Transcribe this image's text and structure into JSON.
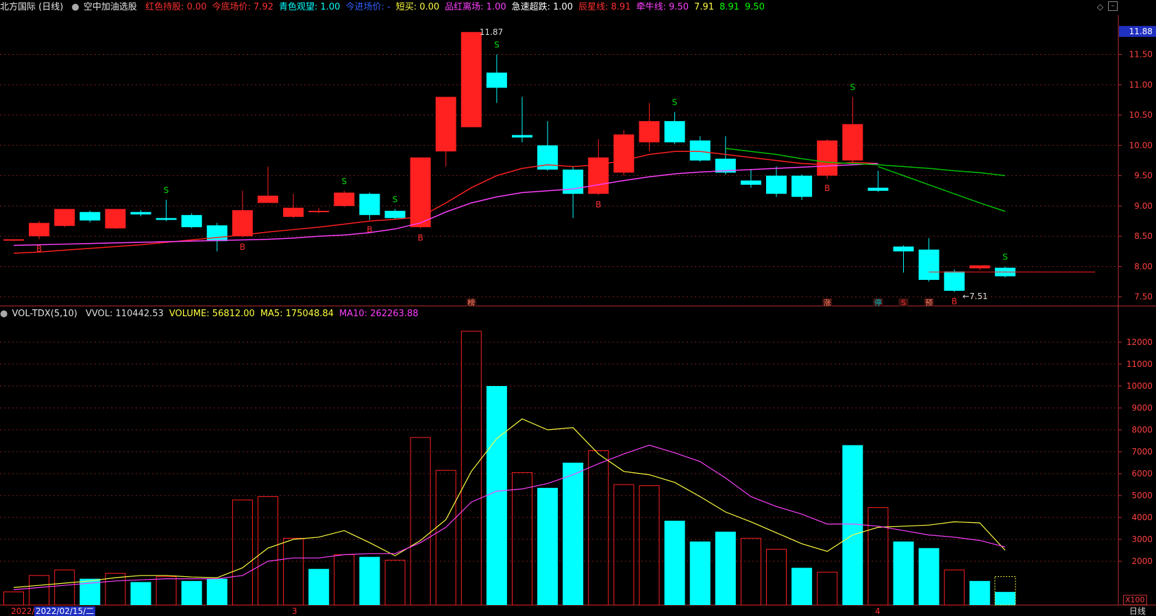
{
  "header": {
    "stock": "北方国际 (日线)",
    "formula": "空中加油选股",
    "items": [
      {
        "label": "红色持股:",
        "value": "0.00",
        "color": "#ff3030"
      },
      {
        "label": "今底场价:",
        "value": "7.92",
        "color": "#ff3030"
      },
      {
        "label": "青色观望:",
        "value": "1.00",
        "color": "#00ffff"
      },
      {
        "label": "今进场价:",
        "value": "-",
        "color": "#3060ff"
      },
      {
        "label": "短买:",
        "value": "0.00",
        "color": "#ffff40"
      },
      {
        "label": "品红离场:",
        "value": "1.00",
        "color": "#ff40ff"
      },
      {
        "label": "急速超跌:",
        "value": "1.00",
        "color": "#ffffff"
      },
      {
        "label": "辰星线:",
        "value": "8.91",
        "color": "#ff3030"
      },
      {
        "label": "牵牛线:",
        "value": "9.50",
        "color": "#ff40ff"
      },
      {
        "label": "",
        "value": "7.91",
        "color": "#ffff40"
      },
      {
        "label": "",
        "value": "8.91",
        "color": "#00ff00"
      },
      {
        "label": "",
        "value": "9.50",
        "color": "#00ff00"
      }
    ]
  },
  "volume_header": {
    "name": "VOL-TDX(5,10)",
    "items": [
      {
        "label": "VVOL:",
        "value": "110442.53",
        "color": "#dddddd"
      },
      {
        "label": "VOLUME:",
        "value": "56812.00",
        "color": "#ffff40"
      },
      {
        "label": "MA5:",
        "value": "175048.84",
        "color": "#ffff40"
      },
      {
        "label": "MA10:",
        "value": "262263.88",
        "color": "#ff40ff"
      }
    ]
  },
  "footer": {
    "date_partial": "2022/0",
    "date_cursor": "2022/02/15/二",
    "month_labels": [
      "3",
      "4"
    ],
    "period": "日线",
    "vol_unit": "X100"
  },
  "markers": {
    "high": "11.87",
    "low": "←7.51",
    "current_price": "11.88",
    "events": [
      "榜",
      "涨",
      "停",
      "S",
      "预"
    ]
  },
  "colors": {
    "up": "#ff2020",
    "down": "#00ffff",
    "ma_red": "#ff2020",
    "ma_magenta": "#ff40ff",
    "ma_green": "#00c000",
    "vol_ma5": "#ffff40",
    "vol_ma10": "#ff40ff",
    "axis": "#c03030"
  },
  "chart_data": [
    {
      "type": "candlestick",
      "yticks": [
        8.0,
        8.5,
        9.0,
        9.5,
        10.0,
        10.5,
        11.0,
        11.5,
        7.5
      ],
      "ylim": [
        7.35,
        12.15
      ],
      "candles": [
        {
          "o": 8.43,
          "c": 8.45,
          "h": 8.45,
          "l": 8.42,
          "sig": ""
        },
        {
          "o": 8.5,
          "c": 8.72,
          "h": 8.75,
          "l": 8.45,
          "sig": "B"
        },
        {
          "o": 8.67,
          "c": 8.95,
          "h": 8.95,
          "l": 8.65,
          "sig": ""
        },
        {
          "o": 8.9,
          "c": 8.76,
          "h": 8.92,
          "l": 8.73,
          "sig": ""
        },
        {
          "o": 8.63,
          "c": 8.95,
          "h": 8.95,
          "l": 8.62,
          "sig": ""
        },
        {
          "o": 8.9,
          "c": 8.86,
          "h": 8.93,
          "l": 8.83,
          "sig": ""
        },
        {
          "o": 8.8,
          "c": 8.77,
          "h": 9.1,
          "l": 8.75,
          "sig": "S"
        },
        {
          "o": 8.85,
          "c": 8.65,
          "h": 8.88,
          "l": 8.63,
          "sig": ""
        },
        {
          "o": 8.68,
          "c": 8.42,
          "h": 8.72,
          "l": 8.25,
          "sig": ""
        },
        {
          "o": 8.5,
          "c": 8.93,
          "h": 9.25,
          "l": 8.48,
          "sig": "B"
        },
        {
          "o": 9.05,
          "c": 9.17,
          "h": 9.65,
          "l": 9.05,
          "sig": ""
        },
        {
          "o": 8.82,
          "c": 8.97,
          "h": 9.2,
          "l": 8.8,
          "sig": ""
        },
        {
          "o": 8.92,
          "c": 8.92,
          "h": 8.97,
          "l": 8.88,
          "sig": ""
        },
        {
          "o": 9.0,
          "c": 9.22,
          "h": 9.25,
          "l": 8.98,
          "sig": "S"
        },
        {
          "o": 9.2,
          "c": 8.85,
          "h": 9.22,
          "l": 8.77,
          "sig": "B"
        },
        {
          "o": 8.92,
          "c": 8.8,
          "h": 8.95,
          "l": 8.78,
          "sig": "S"
        },
        {
          "o": 8.65,
          "c": 9.8,
          "h": 9.8,
          "l": 8.63,
          "sig": "B"
        },
        {
          "o": 9.9,
          "c": 10.8,
          "h": 10.8,
          "l": 9.65,
          "sig": ""
        },
        {
          "o": 10.3,
          "c": 11.87,
          "h": 11.87,
          "l": 10.3,
          "sig": ""
        },
        {
          "o": 11.2,
          "c": 10.95,
          "h": 11.5,
          "l": 10.7,
          "sig": "S"
        },
        {
          "o": 10.17,
          "c": 10.13,
          "h": 10.8,
          "l": 10.05,
          "sig": ""
        },
        {
          "o": 10.0,
          "c": 9.6,
          "h": 10.4,
          "l": 9.58,
          "sig": ""
        },
        {
          "o": 9.6,
          "c": 9.2,
          "h": 9.65,
          "l": 8.8,
          "sig": ""
        },
        {
          "o": 9.2,
          "c": 9.8,
          "h": 10.1,
          "l": 9.18,
          "sig": "B"
        },
        {
          "o": 9.55,
          "c": 10.18,
          "h": 10.25,
          "l": 9.5,
          "sig": ""
        },
        {
          "o": 10.05,
          "c": 10.4,
          "h": 10.7,
          "l": 9.9,
          "sig": ""
        },
        {
          "o": 10.4,
          "c": 10.05,
          "h": 10.55,
          "l": 10.02,
          "sig": "S"
        },
        {
          "o": 10.08,
          "c": 9.75,
          "h": 10.15,
          "l": 9.73,
          "sig": ""
        },
        {
          "o": 9.78,
          "c": 9.55,
          "h": 10.15,
          "l": 9.52,
          "sig": ""
        },
        {
          "o": 9.42,
          "c": 9.35,
          "h": 9.6,
          "l": 9.3,
          "sig": ""
        },
        {
          "o": 9.5,
          "c": 9.2,
          "h": 9.65,
          "l": 9.15,
          "sig": ""
        },
        {
          "o": 9.5,
          "c": 9.15,
          "h": 9.52,
          "l": 9.1,
          "sig": ""
        },
        {
          "o": 9.5,
          "c": 10.08,
          "h": 10.1,
          "l": 9.45,
          "sig": "B"
        },
        {
          "o": 9.75,
          "c": 10.35,
          "h": 10.8,
          "l": 9.72,
          "sig": "S"
        },
        {
          "o": 9.3,
          "c": 9.25,
          "h": 9.58,
          "l": 9.23,
          "sig": ""
        },
        {
          "o": 8.33,
          "c": 8.25,
          "h": 8.35,
          "l": 7.9,
          "sig": ""
        },
        {
          "o": 8.28,
          "c": 7.78,
          "h": 8.47,
          "l": 7.75,
          "sig": ""
        },
        {
          "o": 7.92,
          "c": 7.6,
          "h": 7.95,
          "l": 7.58,
          "sig": "B"
        },
        {
          "o": 7.97,
          "c": 8.02,
          "h": 8.02,
          "l": 7.94,
          "sig": ""
        },
        {
          "o": 7.98,
          "c": 7.84,
          "h": 8.0,
          "l": 7.82,
          "sig": "S"
        }
      ],
      "ma_red": [
        8.22,
        8.24,
        8.27,
        8.3,
        8.33,
        8.36,
        8.4,
        8.44,
        8.48,
        8.52,
        8.57,
        8.61,
        8.65,
        8.7,
        8.75,
        8.78,
        8.82,
        9.05,
        9.3,
        9.5,
        9.62,
        9.68,
        9.65,
        9.68,
        9.75,
        9.85,
        9.9,
        9.9,
        9.85,
        9.8,
        9.75,
        9.7,
        9.68,
        9.72,
        9.7
      ],
      "ma_magenta": [
        8.35,
        8.36,
        8.37,
        8.38,
        8.39,
        8.4,
        8.41,
        8.42,
        8.43,
        8.44,
        8.45,
        8.47,
        8.5,
        8.52,
        8.56,
        8.62,
        8.72,
        8.9,
        9.05,
        9.15,
        9.22,
        9.25,
        9.28,
        9.35,
        9.42,
        9.48,
        9.53,
        9.56,
        9.58,
        9.6,
        9.62,
        9.64,
        9.66,
        9.68,
        9.7
      ],
      "ma_green": [
        9.95,
        9.9,
        9.85,
        9.78,
        9.72,
        9.7,
        9.68,
        9.65,
        9.62,
        9.58,
        9.55,
        9.5
      ],
      "ma_green_down": [
        9.65,
        9.5,
        9.35,
        9.2,
        9.05,
        8.91
      ]
    },
    {
      "type": "bar",
      "yticks": [
        2000,
        3000,
        4000,
        5000,
        6000,
        7000,
        8000,
        9000,
        10000,
        11000,
        12000
      ],
      "ylim": [
        0,
        13000
      ],
      "volumes": [
        600,
        1350,
        1600,
        1200,
        1450,
        1050,
        1300,
        1100,
        1200,
        4800,
        4950,
        3050,
        1650,
        2300,
        2200,
        2050,
        7650,
        6150,
        12500,
        10000,
        6050,
        5350,
        6500,
        7050,
        5500,
        5450,
        3850,
        2900,
        3350,
        3050,
        2550,
        1700,
        1500,
        7300,
        4450,
        2900,
        2600,
        1600,
        1100,
        600
      ],
      "vol_up": [
        true,
        true,
        true,
        false,
        true,
        false,
        true,
        false,
        false,
        true,
        true,
        true,
        false,
        true,
        false,
        true,
        true,
        true,
        true,
        false,
        true,
        false,
        false,
        true,
        true,
        true,
        false,
        false,
        false,
        true,
        true,
        false,
        true,
        false,
        true,
        false,
        false,
        true,
        false,
        false
      ],
      "ma5": [
        800,
        900,
        1000,
        1100,
        1250,
        1350,
        1350,
        1280,
        1250,
        1700,
        2600,
        3000,
        3100,
        3400,
        2850,
        2250,
        2950,
        3900,
        6100,
        7600,
        8500,
        8000,
        8100,
        6900,
        6100,
        5950,
        5600,
        4950,
        4250,
        3800,
        3300,
        2800,
        2450,
        3200,
        3550,
        3600,
        3650,
        3800,
        3750,
        2500
      ],
      "ma10": [
        700,
        800,
        900,
        1000,
        1100,
        1150,
        1200,
        1200,
        1200,
        1350,
        2000,
        2150,
        2150,
        2300,
        2350,
        2350,
        2850,
        3550,
        4700,
        5200,
        5300,
        5550,
        5950,
        6450,
        6900,
        7300,
        6950,
        6550,
        5800,
        4950,
        4500,
        4150,
        3700,
        3700,
        3600,
        3400,
        3200,
        3100,
        2950,
        2650
      ],
      "dotted_last": true
    }
  ]
}
